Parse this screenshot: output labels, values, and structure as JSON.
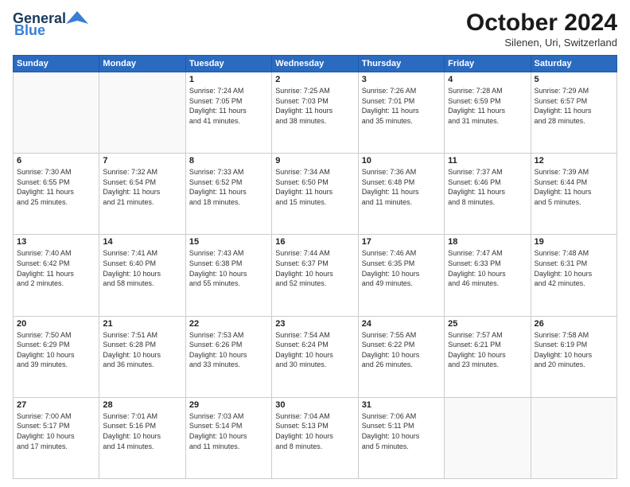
{
  "logo": {
    "line1": "General",
    "line2": "Blue"
  },
  "header": {
    "month": "October 2024",
    "location": "Silenen, Uri, Switzerland"
  },
  "weekdays": [
    "Sunday",
    "Monday",
    "Tuesday",
    "Wednesday",
    "Thursday",
    "Friday",
    "Saturday"
  ],
  "weeks": [
    [
      {
        "day": "",
        "detail": ""
      },
      {
        "day": "",
        "detail": ""
      },
      {
        "day": "1",
        "detail": "Sunrise: 7:24 AM\nSunset: 7:05 PM\nDaylight: 11 hours\nand 41 minutes."
      },
      {
        "day": "2",
        "detail": "Sunrise: 7:25 AM\nSunset: 7:03 PM\nDaylight: 11 hours\nand 38 minutes."
      },
      {
        "day": "3",
        "detail": "Sunrise: 7:26 AM\nSunset: 7:01 PM\nDaylight: 11 hours\nand 35 minutes."
      },
      {
        "day": "4",
        "detail": "Sunrise: 7:28 AM\nSunset: 6:59 PM\nDaylight: 11 hours\nand 31 minutes."
      },
      {
        "day": "5",
        "detail": "Sunrise: 7:29 AM\nSunset: 6:57 PM\nDaylight: 11 hours\nand 28 minutes."
      }
    ],
    [
      {
        "day": "6",
        "detail": "Sunrise: 7:30 AM\nSunset: 6:55 PM\nDaylight: 11 hours\nand 25 minutes."
      },
      {
        "day": "7",
        "detail": "Sunrise: 7:32 AM\nSunset: 6:54 PM\nDaylight: 11 hours\nand 21 minutes."
      },
      {
        "day": "8",
        "detail": "Sunrise: 7:33 AM\nSunset: 6:52 PM\nDaylight: 11 hours\nand 18 minutes."
      },
      {
        "day": "9",
        "detail": "Sunrise: 7:34 AM\nSunset: 6:50 PM\nDaylight: 11 hours\nand 15 minutes."
      },
      {
        "day": "10",
        "detail": "Sunrise: 7:36 AM\nSunset: 6:48 PM\nDaylight: 11 hours\nand 11 minutes."
      },
      {
        "day": "11",
        "detail": "Sunrise: 7:37 AM\nSunset: 6:46 PM\nDaylight: 11 hours\nand 8 minutes."
      },
      {
        "day": "12",
        "detail": "Sunrise: 7:39 AM\nSunset: 6:44 PM\nDaylight: 11 hours\nand 5 minutes."
      }
    ],
    [
      {
        "day": "13",
        "detail": "Sunrise: 7:40 AM\nSunset: 6:42 PM\nDaylight: 11 hours\nand 2 minutes."
      },
      {
        "day": "14",
        "detail": "Sunrise: 7:41 AM\nSunset: 6:40 PM\nDaylight: 10 hours\nand 58 minutes."
      },
      {
        "day": "15",
        "detail": "Sunrise: 7:43 AM\nSunset: 6:38 PM\nDaylight: 10 hours\nand 55 minutes."
      },
      {
        "day": "16",
        "detail": "Sunrise: 7:44 AM\nSunset: 6:37 PM\nDaylight: 10 hours\nand 52 minutes."
      },
      {
        "day": "17",
        "detail": "Sunrise: 7:46 AM\nSunset: 6:35 PM\nDaylight: 10 hours\nand 49 minutes."
      },
      {
        "day": "18",
        "detail": "Sunrise: 7:47 AM\nSunset: 6:33 PM\nDaylight: 10 hours\nand 46 minutes."
      },
      {
        "day": "19",
        "detail": "Sunrise: 7:48 AM\nSunset: 6:31 PM\nDaylight: 10 hours\nand 42 minutes."
      }
    ],
    [
      {
        "day": "20",
        "detail": "Sunrise: 7:50 AM\nSunset: 6:29 PM\nDaylight: 10 hours\nand 39 minutes."
      },
      {
        "day": "21",
        "detail": "Sunrise: 7:51 AM\nSunset: 6:28 PM\nDaylight: 10 hours\nand 36 minutes."
      },
      {
        "day": "22",
        "detail": "Sunrise: 7:53 AM\nSunset: 6:26 PM\nDaylight: 10 hours\nand 33 minutes."
      },
      {
        "day": "23",
        "detail": "Sunrise: 7:54 AM\nSunset: 6:24 PM\nDaylight: 10 hours\nand 30 minutes."
      },
      {
        "day": "24",
        "detail": "Sunrise: 7:55 AM\nSunset: 6:22 PM\nDaylight: 10 hours\nand 26 minutes."
      },
      {
        "day": "25",
        "detail": "Sunrise: 7:57 AM\nSunset: 6:21 PM\nDaylight: 10 hours\nand 23 minutes."
      },
      {
        "day": "26",
        "detail": "Sunrise: 7:58 AM\nSunset: 6:19 PM\nDaylight: 10 hours\nand 20 minutes."
      }
    ],
    [
      {
        "day": "27",
        "detail": "Sunrise: 7:00 AM\nSunset: 5:17 PM\nDaylight: 10 hours\nand 17 minutes."
      },
      {
        "day": "28",
        "detail": "Sunrise: 7:01 AM\nSunset: 5:16 PM\nDaylight: 10 hours\nand 14 minutes."
      },
      {
        "day": "29",
        "detail": "Sunrise: 7:03 AM\nSunset: 5:14 PM\nDaylight: 10 hours\nand 11 minutes."
      },
      {
        "day": "30",
        "detail": "Sunrise: 7:04 AM\nSunset: 5:13 PM\nDaylight: 10 hours\nand 8 minutes."
      },
      {
        "day": "31",
        "detail": "Sunrise: 7:06 AM\nSunset: 5:11 PM\nDaylight: 10 hours\nand 5 minutes."
      },
      {
        "day": "",
        "detail": ""
      },
      {
        "day": "",
        "detail": ""
      }
    ]
  ]
}
